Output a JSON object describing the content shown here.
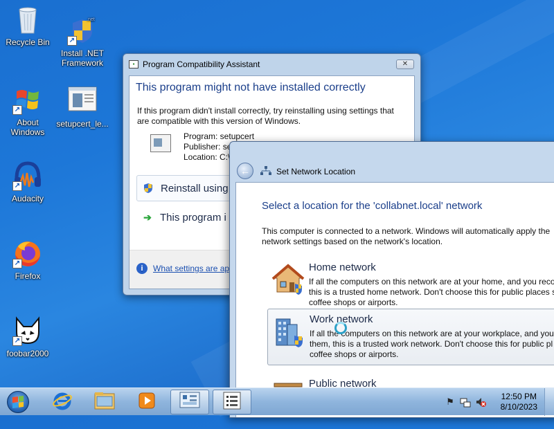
{
  "desktop": {
    "icons": [
      {
        "label": "Recycle Bin",
        "icon": "recycle-bin-icon"
      },
      {
        "label": "Install .NET Framework",
        "icon": "dotnet-installer-icon"
      },
      {
        "label": "About Windows",
        "icon": "windows-logo-icon"
      },
      {
        "label": "setupcert_le...",
        "icon": "program-window-icon"
      },
      {
        "label": "Audacity",
        "icon": "audacity-headphones-icon"
      },
      {
        "label": "Firefox",
        "icon": "firefox-icon"
      },
      {
        "label": "foobar2000",
        "icon": "foobar2000-icon"
      }
    ]
  },
  "compat_window": {
    "title": "Program Compatibility Assistant",
    "close_label": "✕",
    "heading": "This program might not have installed correctly",
    "description": "If this program didn't install correctly, try reinstalling using settings that are compatible with this version of Windows.",
    "program": "Program: setupcert",
    "publisher": "Publisher: set",
    "location": "Location: C:\\",
    "reinstall_label": "Reinstall using r",
    "installed_label": "This program i",
    "help_link": "What settings are app"
  },
  "network_window": {
    "title": "Set Network Location",
    "heading": "Select a location for the 'collabnet.local' network",
    "description_line1": "This computer is connected to a network. Windows will automatically apply the",
    "description_line2": "network settings based on the network's location.",
    "options": [
      {
        "name": "Home network",
        "line1": "If all the computers on this network are at your home, and you reco",
        "line2": "this is a trusted home network.  Don't choose this for public places s",
        "line3": "coffee shops or airports."
      },
      {
        "name": "Work network",
        "line1": "If all the computers on this network are at your workplace, and you",
        "line2": "them, this is a trusted work network.  Don't choose this for public pl",
        "line3": "coffee shops or airports."
      },
      {
        "name": "Public network"
      }
    ]
  },
  "taskbar": {
    "pinned": [
      "internet-explorer-icon",
      "file-explorer-icon",
      "media-player-icon",
      "network-window-task-icon",
      "compat-assistant-task-icon"
    ],
    "clock_time": "12:50 PM",
    "clock_date": "8/10/2023"
  },
  "colors": {
    "heading_blue": "#1a3e8a",
    "link_blue": "#1a4fb0",
    "desktop_blue": "#1d77d8"
  }
}
